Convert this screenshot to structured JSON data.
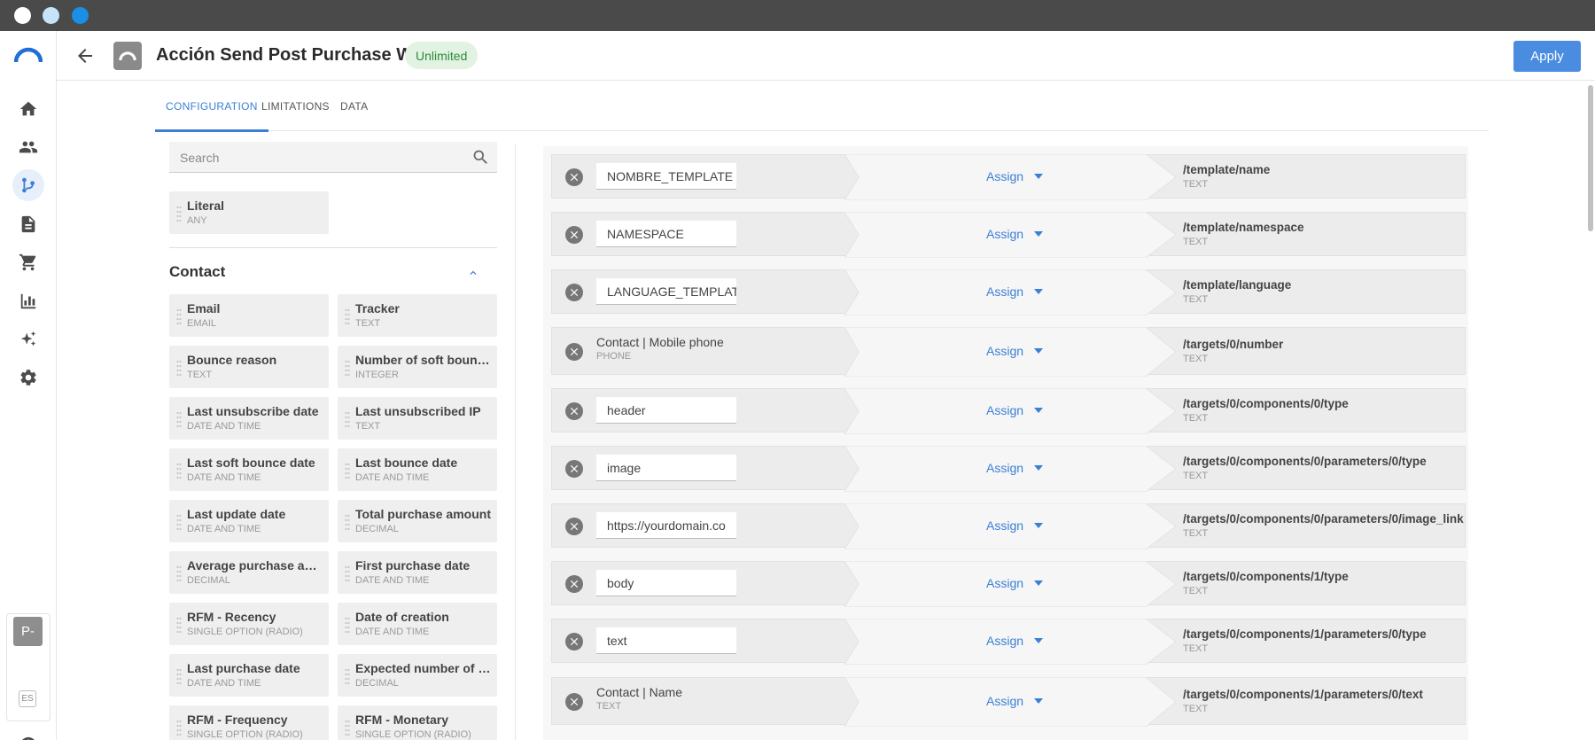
{
  "header": {
    "title": "Acción Send Post Purchase W...",
    "badge": "Unlimited",
    "apply_label": "Apply"
  },
  "nav": {
    "items": [
      "home-icon",
      "contacts-icon",
      "automation-icon",
      "content-icon",
      "cart-icon",
      "reports-icon",
      "ai-sparkle-icon",
      "settings-icon",
      "user-icon"
    ],
    "workspace_badge": "P-",
    "language_badge": "ES"
  },
  "tabs": [
    {
      "label": "CONFIGURATION",
      "active": true
    },
    {
      "label": "LIMITATIONS",
      "active": false
    },
    {
      "label": "DATA",
      "active": false
    }
  ],
  "palette": {
    "search_placeholder": "Search",
    "literal": {
      "name": "Literal",
      "type": "ANY"
    },
    "section": "Contact",
    "fields": [
      {
        "name": "Email",
        "type": "EMAIL"
      },
      {
        "name": "Tracker",
        "type": "TEXT"
      },
      {
        "name": "Bounce reason",
        "type": "TEXT"
      },
      {
        "name": "Number of soft bounces",
        "type": "INTEGER"
      },
      {
        "name": "Last unsubscribe date",
        "type": "DATE AND TIME"
      },
      {
        "name": "Last unsubscribed IP",
        "type": "TEXT"
      },
      {
        "name": "Last soft bounce date",
        "type": "DATE AND TIME"
      },
      {
        "name": "Last bounce date",
        "type": "DATE AND TIME"
      },
      {
        "name": "Last update date",
        "type": "DATE AND TIME"
      },
      {
        "name": "Total purchase amount",
        "type": "DECIMAL"
      },
      {
        "name": "Average purchase amo...",
        "type": "DECIMAL"
      },
      {
        "name": "First purchase date",
        "type": "DATE AND TIME"
      },
      {
        "name": "RFM - Recency",
        "type": "SINGLE OPTION (RADIO)"
      },
      {
        "name": "Date of creation",
        "type": "DATE AND TIME"
      },
      {
        "name": "Last purchase date",
        "type": "DATE AND TIME"
      },
      {
        "name": "Expected number of p...",
        "type": "DECIMAL"
      },
      {
        "name": "RFM - Frequency",
        "type": "SINGLE OPTION (RADIO)"
      },
      {
        "name": "RFM - Monetary",
        "type": "SINGLE OPTION (RADIO)"
      }
    ]
  },
  "mappings": [
    {
      "source": "NOMBRE_TEMPLATE",
      "kind": "literal",
      "action": "Assign",
      "dest": "/template/name",
      "dest_type": "TEXT"
    },
    {
      "source": "NAMESPACE",
      "kind": "literal",
      "action": "Assign",
      "dest": "/template/namespace",
      "dest_type": "TEXT"
    },
    {
      "source": "LANGUAGE_TEMPLATE",
      "kind": "literal",
      "action": "Assign",
      "dest": "/template/language",
      "dest_type": "TEXT"
    },
    {
      "source": "Contact | Mobile phone",
      "source_type": "PHONE",
      "kind": "field",
      "action": "Assign",
      "dest": "/targets/0/number",
      "dest_type": "TEXT"
    },
    {
      "source": "header",
      "kind": "literal",
      "action": "Assign",
      "dest": "/targets/0/components/0/type",
      "dest_type": "TEXT"
    },
    {
      "source": "image",
      "kind": "literal",
      "action": "Assign",
      "dest": "/targets/0/components/0/parameters/0/type",
      "dest_type": "TEXT"
    },
    {
      "source": "https://yourdomain.co",
      "kind": "literal",
      "action": "Assign",
      "dest": "/targets/0/components/0/parameters/0/image_link",
      "dest_type": "TEXT"
    },
    {
      "source": "body",
      "kind": "literal",
      "action": "Assign",
      "dest": "/targets/0/components/1/type",
      "dest_type": "TEXT"
    },
    {
      "source": "text",
      "kind": "literal",
      "action": "Assign",
      "dest": "/targets/0/components/1/parameters/0/type",
      "dest_type": "TEXT"
    },
    {
      "source": "Contact | Name",
      "source_type": "TEXT",
      "kind": "field",
      "action": "Assign",
      "dest": "/targets/0/components/1/parameters/0/text",
      "dest_type": "TEXT"
    }
  ],
  "colors": {
    "accent": "#3b7fd6",
    "apply_bg": "#4a8ce0",
    "badge_bg": "#e3f3e3",
    "badge_text": "#2e8b3b"
  }
}
